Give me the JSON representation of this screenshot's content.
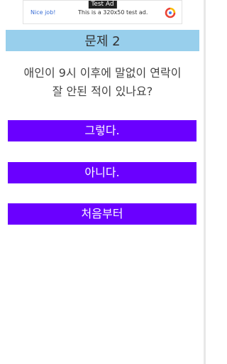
{
  "ad": {
    "tag": "Test Ad",
    "nice_job": "Nice job!",
    "text": "This is a 320x50 test ad.",
    "logo_icon": "adchoices-logo-icon"
  },
  "header": {
    "title": "문제 2"
  },
  "question": {
    "line1": "애인이 9시 이후에 말없이 연락이",
    "line2": "잘 안된 적이 있나요?"
  },
  "buttons": {
    "yes_label": "그렇다.",
    "no_label": "아니다.",
    "restart_label": "처음부터"
  },
  "colors": {
    "title_bar": "#98cfec",
    "button": "#6a00ff",
    "button_text": "#ffffff"
  }
}
